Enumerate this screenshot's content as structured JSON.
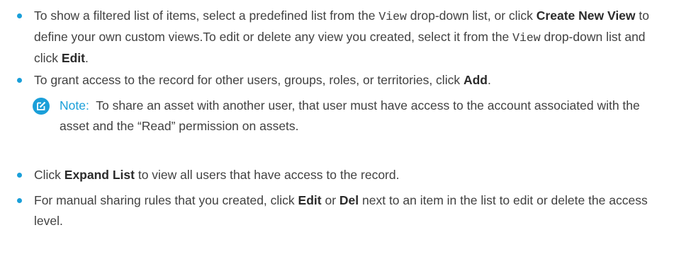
{
  "bullets": [
    {
      "p1": "To show a filtered list of items, select a predefined list from the ",
      "code1": "View",
      "p2": " drop-down list, or click ",
      "b1": "Create New View",
      "p3": " to define your own custom views.To edit or delete any view you created, select it from the ",
      "code2": "View",
      "p4": " drop-down list and click ",
      "b2": "Edit",
      "p5": "."
    },
    {
      "p1": "To grant access to the record for other users, groups, roles, or territories, click ",
      "b1": "Add",
      "p2": "."
    },
    {
      "p1": "Click ",
      "b1": "Expand List",
      "p2": " to view all users that have access to the record."
    },
    {
      "p1": "For manual sharing rules that you created, click ",
      "b1": "Edit",
      "p2": " or ",
      "b2": "Del",
      "p3": " next to an item in the list to edit or delete the access level."
    }
  ],
  "note": {
    "label": "Note:",
    "text": "To share an asset with another user, that user must have access to the account associated with the asset and the “Read” permission on assets.",
    "icon": "edit-note-icon"
  },
  "colors": {
    "accent": "#1a9fd9",
    "text": "#414141"
  }
}
